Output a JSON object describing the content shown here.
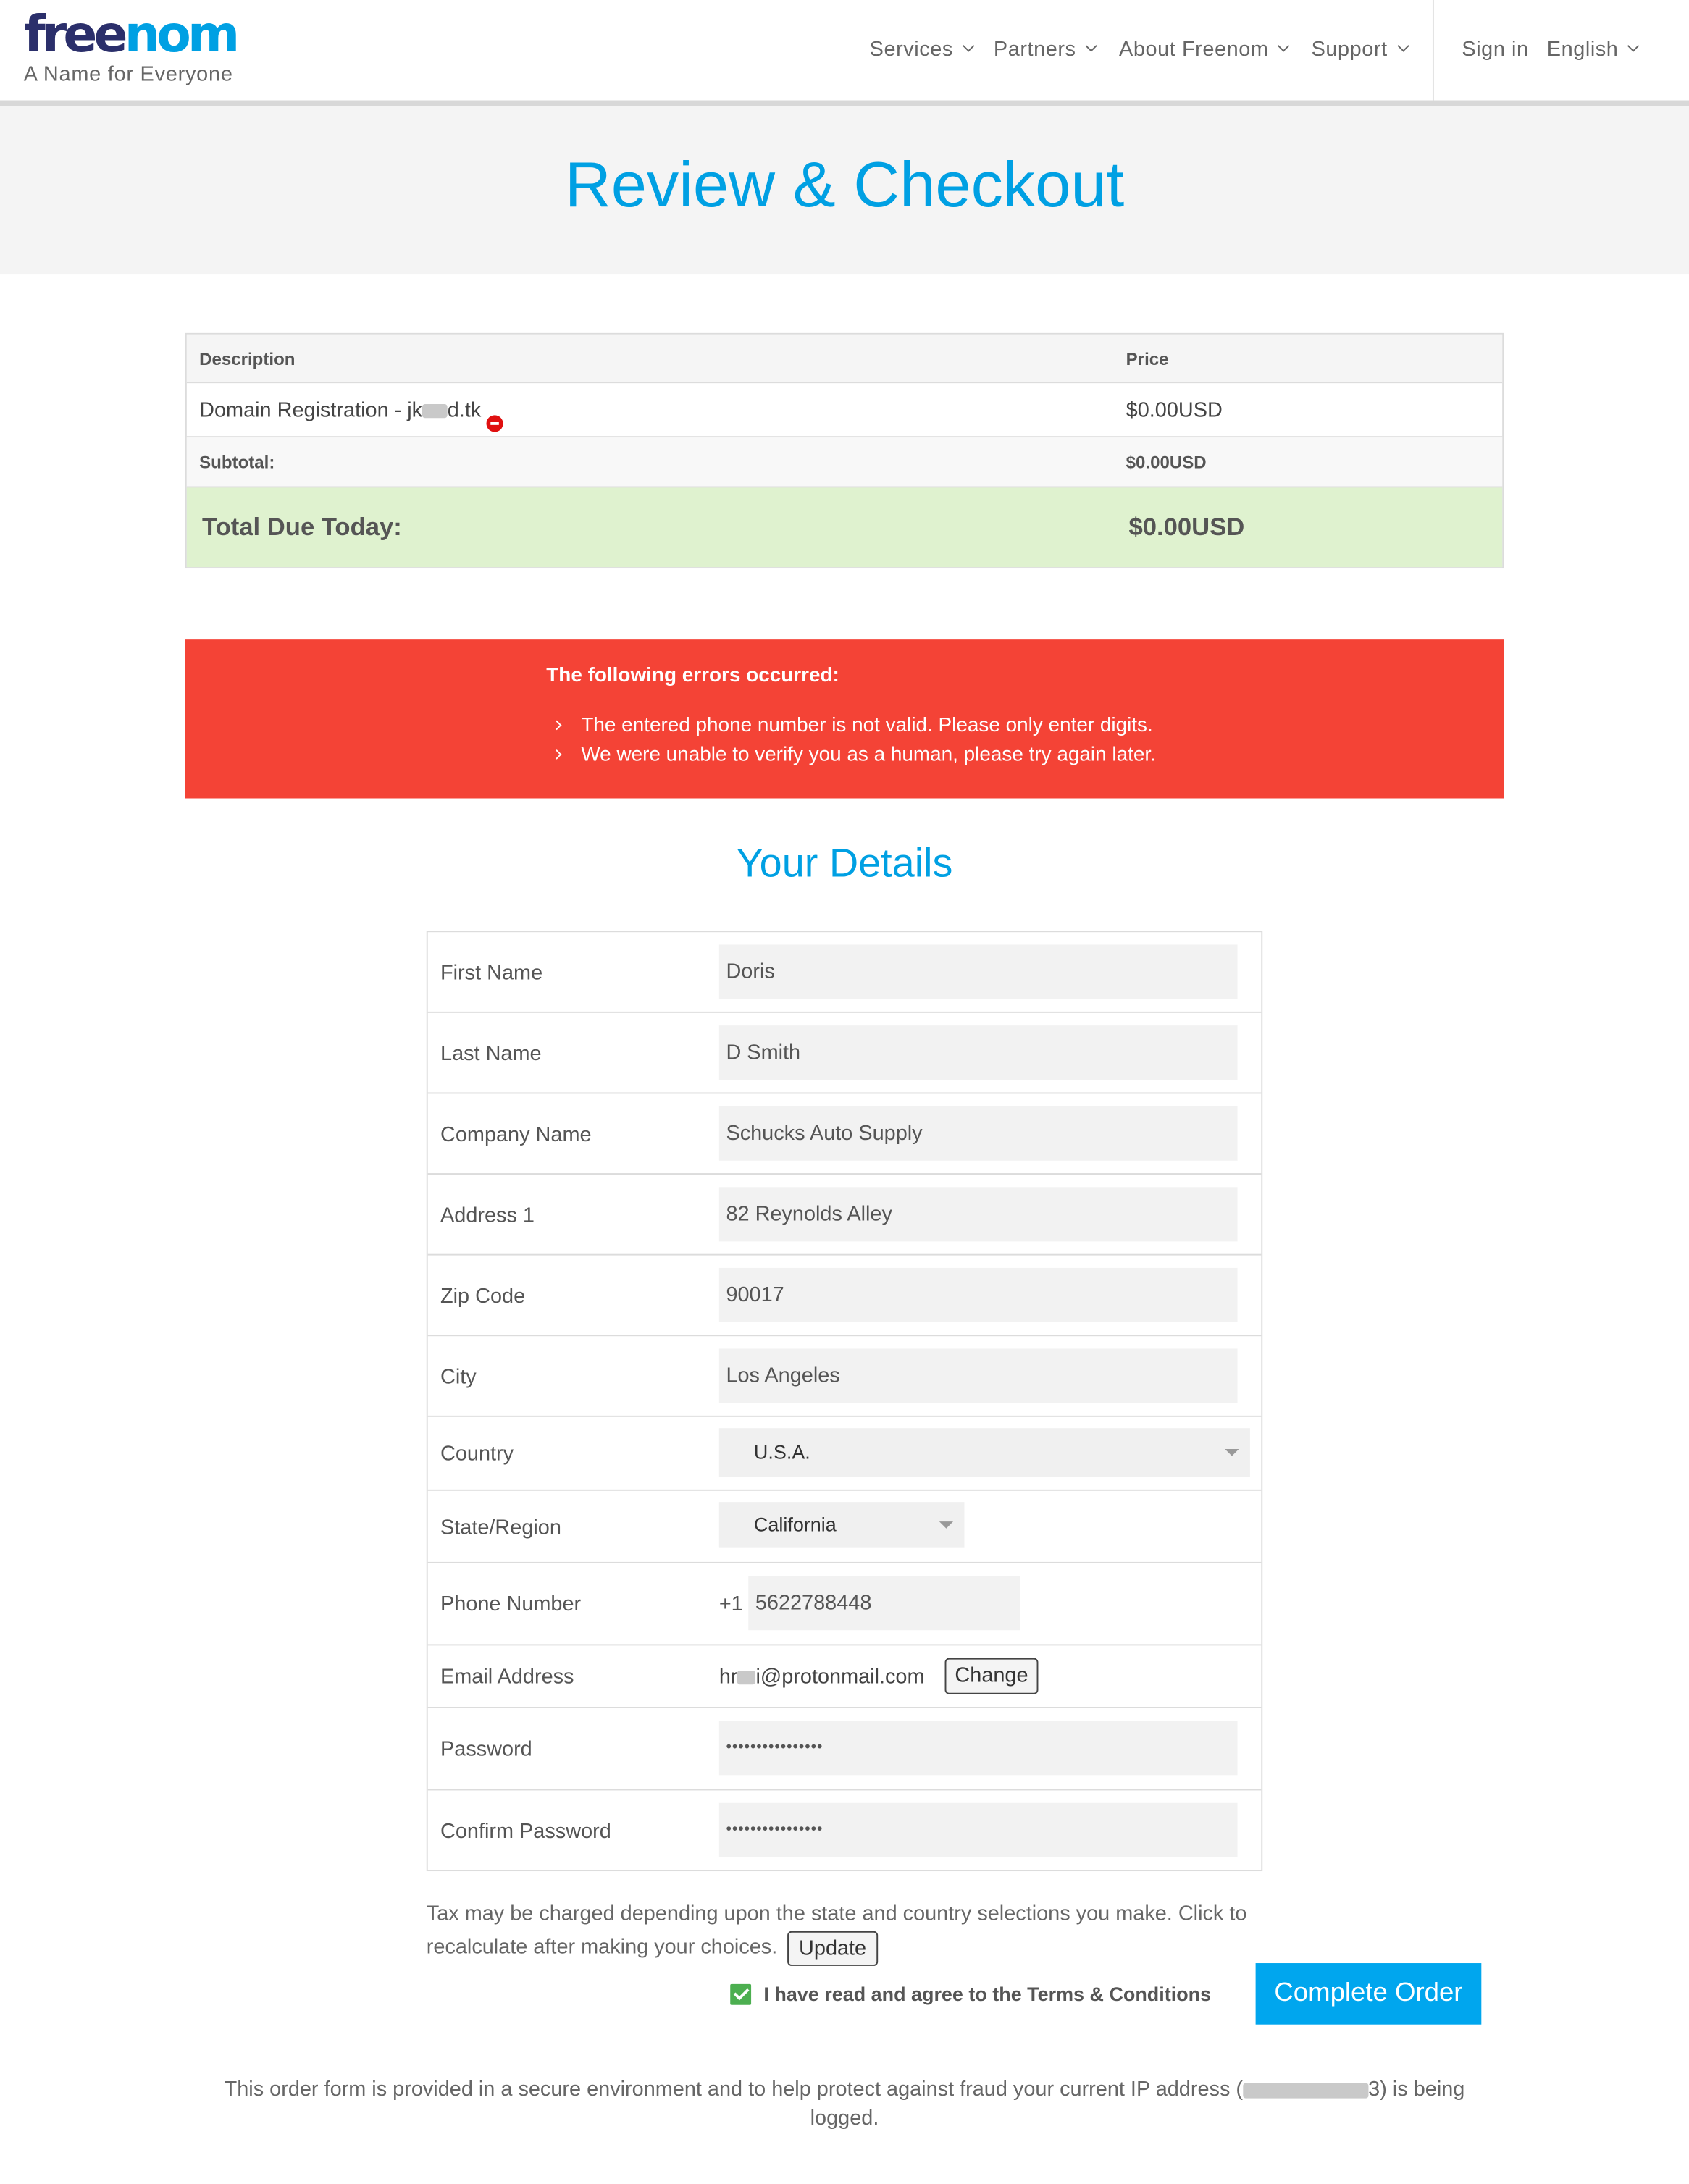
{
  "brand": {
    "logo_free": "free",
    "logo_nom": "nom",
    "tagline": "A Name for Everyone"
  },
  "nav": {
    "items": [
      {
        "label": "Services"
      },
      {
        "label": "Partners"
      },
      {
        "label": "About Freenom"
      },
      {
        "label": "Support"
      }
    ],
    "sign_in": "Sign in",
    "language": "English"
  },
  "page": {
    "title": "Review & Checkout",
    "section_title": "Your Details"
  },
  "cart": {
    "col_description": "Description",
    "col_price": "Price",
    "item_description_prefix": "Domain Registration - jk",
    "item_description_suffix": "d.tk",
    "item_price": "$0.00USD",
    "subtotal_label": "Subtotal:",
    "subtotal_value": "$0.00USD",
    "total_label": "Total Due Today:",
    "total_value": "$0.00USD"
  },
  "errors": {
    "title": "The following errors occurred:",
    "items": [
      "The entered phone number is not valid. Please only enter digits.",
      "We were unable to verify you as a human, please try again later."
    ]
  },
  "form": {
    "first_name": {
      "label": "First Name",
      "value": "Doris"
    },
    "last_name": {
      "label": "Last Name",
      "value": "D Smith"
    },
    "company": {
      "label": "Company Name",
      "value": "Schucks Auto Supply"
    },
    "address1": {
      "label": "Address 1",
      "value": "82 Reynolds Alley"
    },
    "zip": {
      "label": "Zip Code",
      "value": "90017"
    },
    "city": {
      "label": "City",
      "value": "Los Angeles"
    },
    "country": {
      "label": "Country",
      "value": "U.S.A."
    },
    "state": {
      "label": "State/Region",
      "value": "California"
    },
    "phone": {
      "label": "Phone Number",
      "prefix": "+1",
      "value": "5622788448"
    },
    "email": {
      "label": "Email Address",
      "value_prefix": "hr",
      "value_suffix": "i@protonmail.com",
      "change_label": "Change"
    },
    "password": {
      "label": "Password",
      "value": "••••••••••••••••"
    },
    "confirm_password": {
      "label": "Confirm Password",
      "value": "••••••••••••••••"
    }
  },
  "tax_note": "Tax may be charged depending upon the state and country selections you make. Click to recalculate after making your choices.",
  "update_label": "Update",
  "agree_label": "I have read and agree to the Terms & Conditions",
  "complete_label": "Complete Order",
  "footer": {
    "text_before": "This order form is provided in a secure environment and to help protect against fraud your current IP address (",
    "ip_suffix": "3",
    "text_after": ") is being logged."
  },
  "colors": {
    "accent": "#00a0e3",
    "error_bg": "#f44336",
    "total_bg": "#dff2cf",
    "checkbox": "#4caf50",
    "button": "#00a6ee"
  }
}
